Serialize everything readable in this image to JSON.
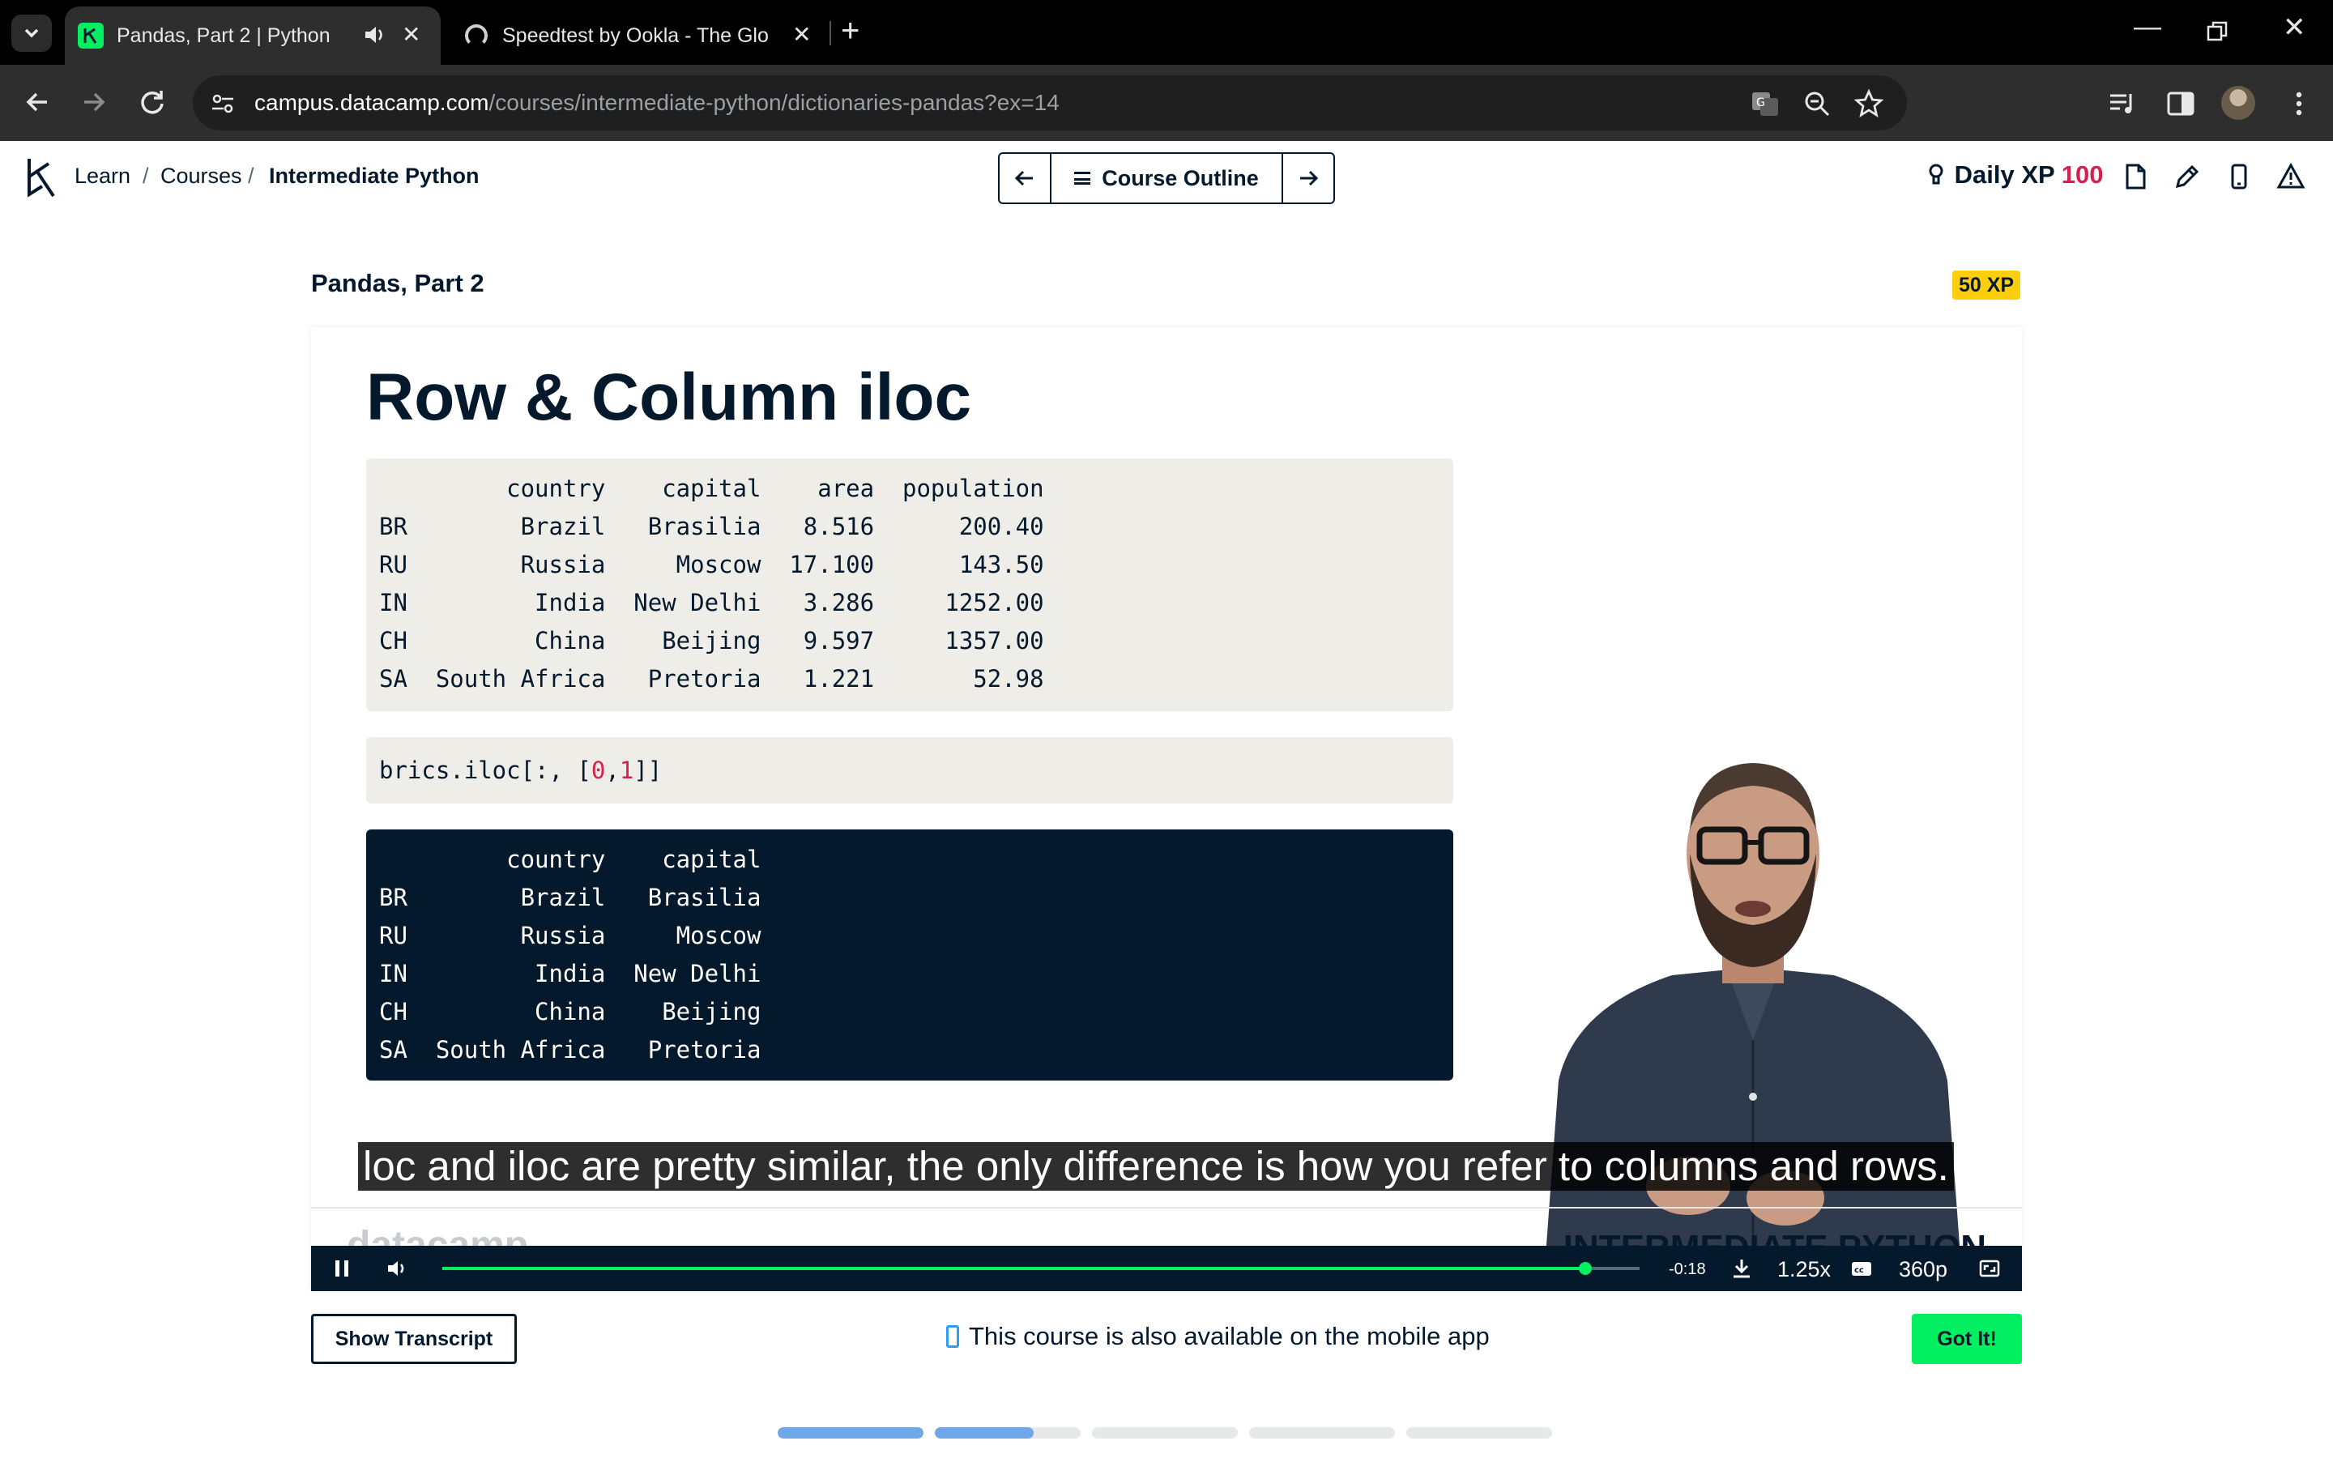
{
  "browser": {
    "tabs": [
      {
        "title": "Pandas, Part 2 | Python",
        "active": true
      },
      {
        "title": "Speedtest by Ookla - The Global Broadband Speed Test",
        "active": false
      }
    ],
    "url_host": "campus.datacamp.com",
    "url_path": "/courses/intermediate-python/dictionaries-pandas?ex=14"
  },
  "header": {
    "breadcrumbs": [
      "Learn",
      "Courses",
      "Intermediate Python"
    ],
    "separator": "/",
    "outline_label": "Course Outline",
    "daily_xp_label": "Daily XP",
    "daily_xp_value": "100"
  },
  "lesson": {
    "title": "Pandas, Part 2",
    "xp_badge": "50 XP"
  },
  "slide": {
    "heading": "Row & Column iloc",
    "dataframe_lines": [
      "         country    capital    area  population",
      "BR        Brazil   Brasilia   8.516      200.40",
      "RU        Russia     Moscow  17.100      143.50",
      "IN         India  New Delhi   3.286     1252.00",
      "CH         China    Beijing   9.597     1357.00",
      "SA  South Africa   Pretoria   1.221       52.98"
    ],
    "code_prefix": "brics.iloc[:, [",
    "code_num_0": "0",
    "code_comma": ",",
    "code_num_1": "1",
    "code_suffix": "]]",
    "output_lines": [
      "         country    capital",
      "BR        Brazil   Brasilia",
      "RU        Russia     Moscow",
      "IN         India  New Delhi",
      "CH         China    Beijing",
      "SA  South Africa   Pretoria"
    ],
    "caption": "loc and iloc are pretty similar, the only difference is how you refer to columns and rows.",
    "footer_logo": "datacamp",
    "footer_course": "INTERMEDIATE PYTHON"
  },
  "player": {
    "time_remaining": "-0:18",
    "speed": "1.25x",
    "quality": "360p",
    "progress": 0.955
  },
  "below_video": {
    "transcript_button": "Show Transcript",
    "mobile_note": "This course is also available on the mobile app",
    "got_it_button": "Got It!"
  },
  "exercise_progress": [
    1.0,
    0.68,
    0.0,
    0.0,
    0.0
  ],
  "colors": {
    "brand_green": "#03ef62",
    "navy": "#05192d",
    "xp_red": "#d6204e",
    "badge_yellow": "#fcce0d"
  }
}
